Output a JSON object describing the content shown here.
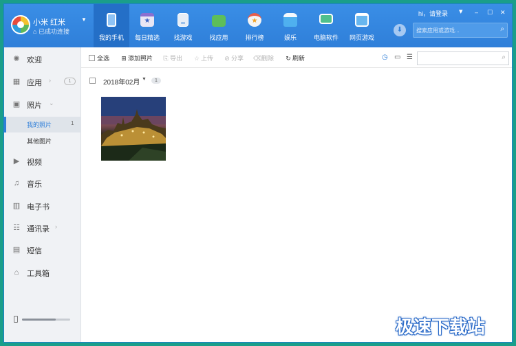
{
  "device": {
    "name": "小米 红米",
    "status": "已成功连接"
  },
  "nav": [
    {
      "label": "我的手机",
      "icon": "phone-icon",
      "active": true,
      "color": "#8fc3f5"
    },
    {
      "label": "每日精选",
      "icon": "calendar-star-icon",
      "active": false,
      "color": "#e9e6f4"
    },
    {
      "label": "找游戏",
      "icon": "gamepad-icon",
      "active": false,
      "color": "#e8eef6"
    },
    {
      "label": "找应用",
      "icon": "bag-icon",
      "active": false,
      "color": "#5dbe5a"
    },
    {
      "label": "排行榜",
      "icon": "medal-icon",
      "active": false,
      "color": "#f4f4f4"
    },
    {
      "label": "娱乐",
      "icon": "entertainment-icon",
      "active": false,
      "color": "#4fb0ef"
    },
    {
      "label": "电脑软件",
      "icon": "monitor-icon",
      "active": false,
      "color": "#4fc08d"
    },
    {
      "label": "网页游戏",
      "icon": "browser-game-icon",
      "active": false,
      "color": "#67b6ef"
    }
  ],
  "window_controls": {
    "greeting": "hi，请登录",
    "menu": "▾",
    "minimize": "–",
    "maximize": "☐",
    "close": "✕"
  },
  "top_search": {
    "placeholder": "搜索应用或游戏..."
  },
  "sidebar": {
    "items": [
      {
        "label": "欢迎",
        "icon": "welcome-icon",
        "glyph": "✺"
      },
      {
        "label": "应用",
        "icon": "apps-icon",
        "glyph": "▦",
        "arrow": "›",
        "badge": "1"
      },
      {
        "label": "照片",
        "icon": "photo-icon",
        "glyph": "▣",
        "arrow": "⌄"
      },
      {
        "label": "视频",
        "icon": "video-icon",
        "glyph": "▶"
      },
      {
        "label": "音乐",
        "icon": "music-icon",
        "glyph": "♫"
      },
      {
        "label": "电子书",
        "icon": "ebook-icon",
        "glyph": "▥"
      },
      {
        "label": "通讯录",
        "icon": "contacts-icon",
        "glyph": "☷",
        "arrow": "›"
      },
      {
        "label": "短信",
        "icon": "sms-icon",
        "glyph": "▤"
      },
      {
        "label": "工具箱",
        "icon": "toolbox-icon",
        "glyph": "⌂"
      }
    ],
    "sub_items": [
      {
        "label": "我的照片",
        "count": "1",
        "active": true
      },
      {
        "label": "其他图片",
        "count": "",
        "active": false
      }
    ],
    "zoom_level": 0.7
  },
  "toolbar": {
    "select_all": "全选",
    "add_photo": "添加照片",
    "export": "导出",
    "upload": "上传",
    "share": "分享",
    "delete": "删除",
    "refresh": "刷新"
  },
  "content_search": {
    "placeholder": ""
  },
  "group": {
    "date": "2018年02月",
    "count": "1"
  },
  "watermark": "极速下载站",
  "colors": {
    "accent": "#2f7fd9",
    "topbar": "#3a8ee6",
    "sidebar_bg": "#f0f2f5"
  }
}
